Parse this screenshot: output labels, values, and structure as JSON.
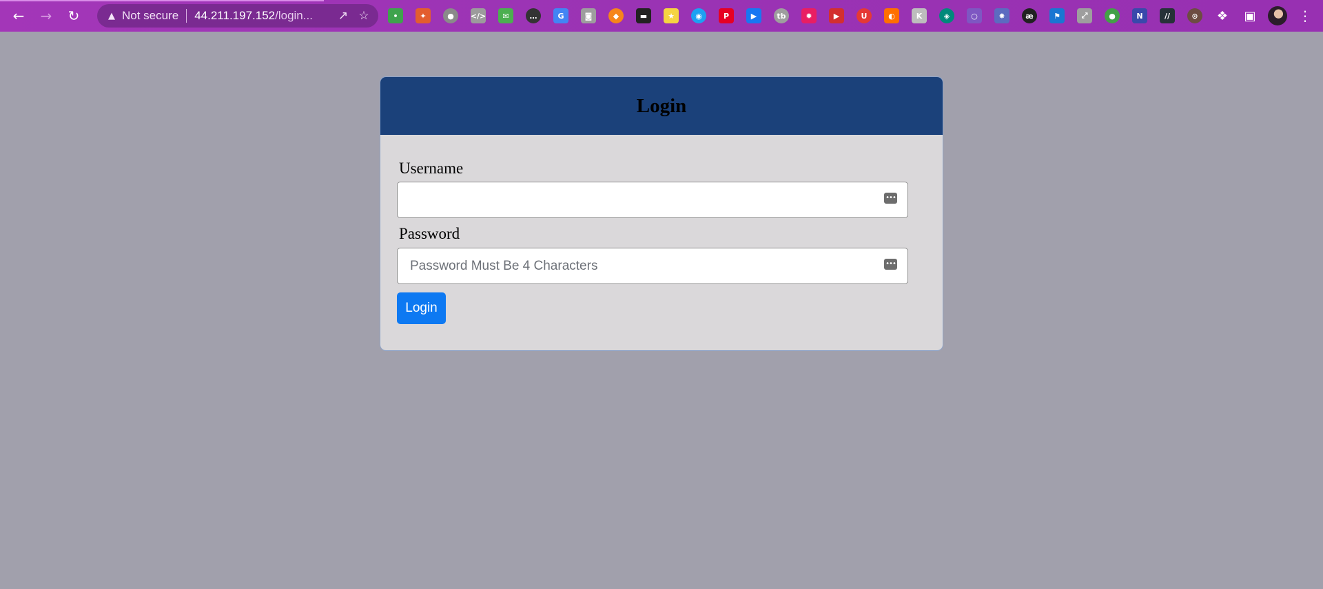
{
  "browser": {
    "back_icon": "←",
    "forward_icon": "→",
    "reload_icon": "↻",
    "warning_icon": "▲",
    "security_label": "Not secure",
    "url_host": "44.211.197.152",
    "url_path": "/login...",
    "share_icon": "↗",
    "star_icon": "☆",
    "extensions_icon": "❖",
    "side_panel_icon": "▣",
    "menu_icon": "⋮",
    "accent_color": "#a336b8",
    "extensions": [
      {
        "name": "ext-1-icon",
        "glyph": "•",
        "color": "#3fa34d"
      },
      {
        "name": "ext-2-icon",
        "glyph": "✦",
        "color": "#e35d2e"
      },
      {
        "name": "ext-3-icon",
        "glyph": "●",
        "color": "#8a8a8a"
      },
      {
        "name": "ext-4-icon",
        "glyph": "</>",
        "color": "#9c9c9c"
      },
      {
        "name": "ext-5-icon",
        "glyph": "✉",
        "color": "#4caf50"
      },
      {
        "name": "ext-6-icon",
        "glyph": "…",
        "color": "#333333"
      },
      {
        "name": "ext-7-icon",
        "glyph": "G",
        "color": "#4285f4"
      },
      {
        "name": "ext-8-icon",
        "glyph": "◙",
        "color": "#9e9e9e"
      },
      {
        "name": "ext-9-icon",
        "glyph": "◆",
        "color": "#f6851b"
      },
      {
        "name": "ext-10-icon",
        "glyph": "▬",
        "color": "#222222"
      },
      {
        "name": "ext-11-icon",
        "glyph": "★",
        "color": "#f5d442"
      },
      {
        "name": "ext-12-icon",
        "glyph": "◉",
        "color": "#1da1f2"
      },
      {
        "name": "ext-13-icon",
        "glyph": "P",
        "color": "#e60023"
      },
      {
        "name": "ext-14-icon",
        "glyph": "▶",
        "color": "#1877f2"
      },
      {
        "name": "ext-15-icon",
        "glyph": "tb",
        "color": "#9e9e9e"
      },
      {
        "name": "ext-16-icon",
        "glyph": "✹",
        "color": "#e91e63"
      },
      {
        "name": "ext-17-icon",
        "glyph": "▶",
        "color": "#d32f2f"
      },
      {
        "name": "ext-18-icon",
        "glyph": "U",
        "color": "#e53935"
      },
      {
        "name": "ext-19-icon",
        "glyph": "◐",
        "color": "#ff6f00"
      },
      {
        "name": "ext-20-icon",
        "glyph": "K",
        "color": "#bdbdbd"
      },
      {
        "name": "ext-21-icon",
        "glyph": "◈",
        "color": "#00897b"
      },
      {
        "name": "ext-22-icon",
        "glyph": "○",
        "color": "#7e57c2"
      },
      {
        "name": "ext-23-icon",
        "glyph": "✸",
        "color": "#5c6bc0"
      },
      {
        "name": "ext-24-icon",
        "glyph": "æ",
        "color": "#212121"
      },
      {
        "name": "ext-25-icon",
        "glyph": "⚑",
        "color": "#1976d2"
      },
      {
        "name": "ext-26-icon",
        "glyph": "⤢",
        "color": "#9e9e9e"
      },
      {
        "name": "ext-27-icon",
        "glyph": "●",
        "color": "#43a047"
      },
      {
        "name": "ext-28-icon",
        "glyph": "N",
        "color": "#3949ab"
      },
      {
        "name": "ext-29-icon",
        "glyph": "//",
        "color": "#263238"
      },
      {
        "name": "ext-30-icon",
        "glyph": "⊙",
        "color": "#6d4c41"
      }
    ]
  },
  "login": {
    "title": "Login",
    "header_color": "#1b417a",
    "username_label": "Username",
    "username_value": "",
    "username_placeholder": "",
    "password_label": "Password",
    "password_value": "",
    "password_placeholder": "Password Must Be 4 Characters",
    "password_manager_icon": "•••",
    "submit_label": "Login",
    "submit_color": "#0d79f2"
  }
}
